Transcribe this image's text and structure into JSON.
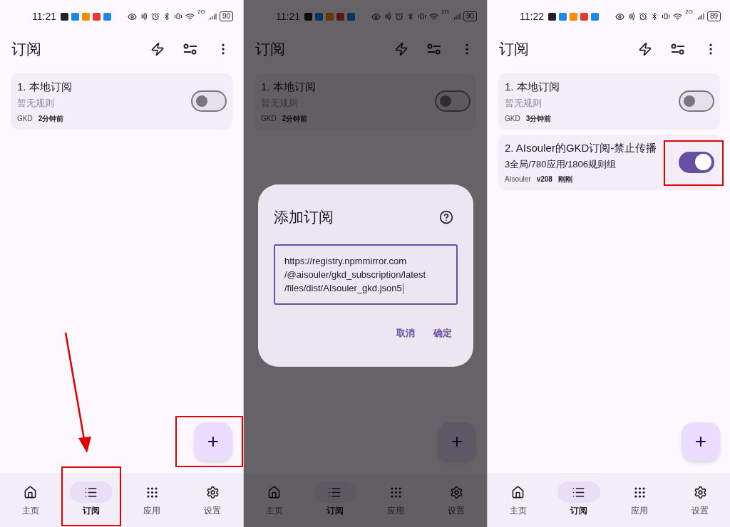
{
  "panels": [
    {
      "status_bar": {
        "time": "11:21",
        "network": "2G",
        "battery": "90"
      },
      "title": "订阅",
      "dimmed": false,
      "arrow": true,
      "subscriptions": [
        {
          "name": "1. 本地订阅",
          "summary": "暂无规则",
          "muted": true,
          "meta": [
            "GKD",
            "2分钟前"
          ],
          "enabled": false,
          "highlighted": false
        }
      ],
      "fab": {
        "label": "+",
        "highlighted": true
      },
      "nav": [
        {
          "label": "主页",
          "selected": false,
          "highlighted": false
        },
        {
          "label": "订阅",
          "selected": true,
          "highlighted": true
        },
        {
          "label": "应用",
          "selected": false,
          "highlighted": false
        },
        {
          "label": "设置",
          "selected": false,
          "highlighted": false
        }
      ]
    },
    {
      "status_bar": {
        "time": "11:21",
        "network": "2G",
        "battery": "90"
      },
      "title": "订阅",
      "dimmed": true,
      "arrow": false,
      "subscriptions": [
        {
          "name": "1. 本地订阅",
          "summary": "暂无规则",
          "muted": true,
          "meta": [
            "GKD",
            "2分钟前"
          ],
          "enabled": false,
          "highlighted": false
        }
      ],
      "fab": {
        "label": "+",
        "highlighted": false
      },
      "nav": [
        {
          "label": "主页",
          "selected": false,
          "highlighted": false
        },
        {
          "label": "订阅",
          "selected": true,
          "highlighted": false
        },
        {
          "label": "应用",
          "selected": false,
          "highlighted": false
        },
        {
          "label": "设置",
          "selected": false,
          "highlighted": false
        }
      ],
      "dialog": {
        "title": "添加订阅",
        "focused": true,
        "value_lines": [
          "https://registry.npmmirror.com",
          "/@aisouler/gkd_subscription/latest",
          "/files/dist/AIsouler_gkd.json5"
        ],
        "buttons": [
          "取消",
          "确定"
        ]
      }
    },
    {
      "status_bar": {
        "time": "11:22",
        "network": "2G",
        "battery": "89"
      },
      "title": "订阅",
      "dimmed": false,
      "arrow": false,
      "subscriptions": [
        {
          "name": "1. 本地订阅",
          "summary": "暂无规则",
          "muted": true,
          "meta": [
            "GKD",
            "3分钟前"
          ],
          "enabled": false,
          "highlighted": false
        },
        {
          "name": "2. AIsouler的GKD订阅-禁止传播",
          "summary": "3全局/780应用/1806规则组",
          "muted": false,
          "meta": [
            "AIsouler",
            "v208",
            "刚刚"
          ],
          "enabled": true,
          "highlighted": true
        }
      ],
      "fab": {
        "label": "+",
        "highlighted": false
      },
      "nav": [
        {
          "label": "主页",
          "selected": false,
          "highlighted": false
        },
        {
          "label": "订阅",
          "selected": true,
          "highlighted": false
        },
        {
          "label": "应用",
          "selected": false,
          "highlighted": false
        },
        {
          "label": "设置",
          "selected": false,
          "highlighted": false
        }
      ]
    }
  ]
}
